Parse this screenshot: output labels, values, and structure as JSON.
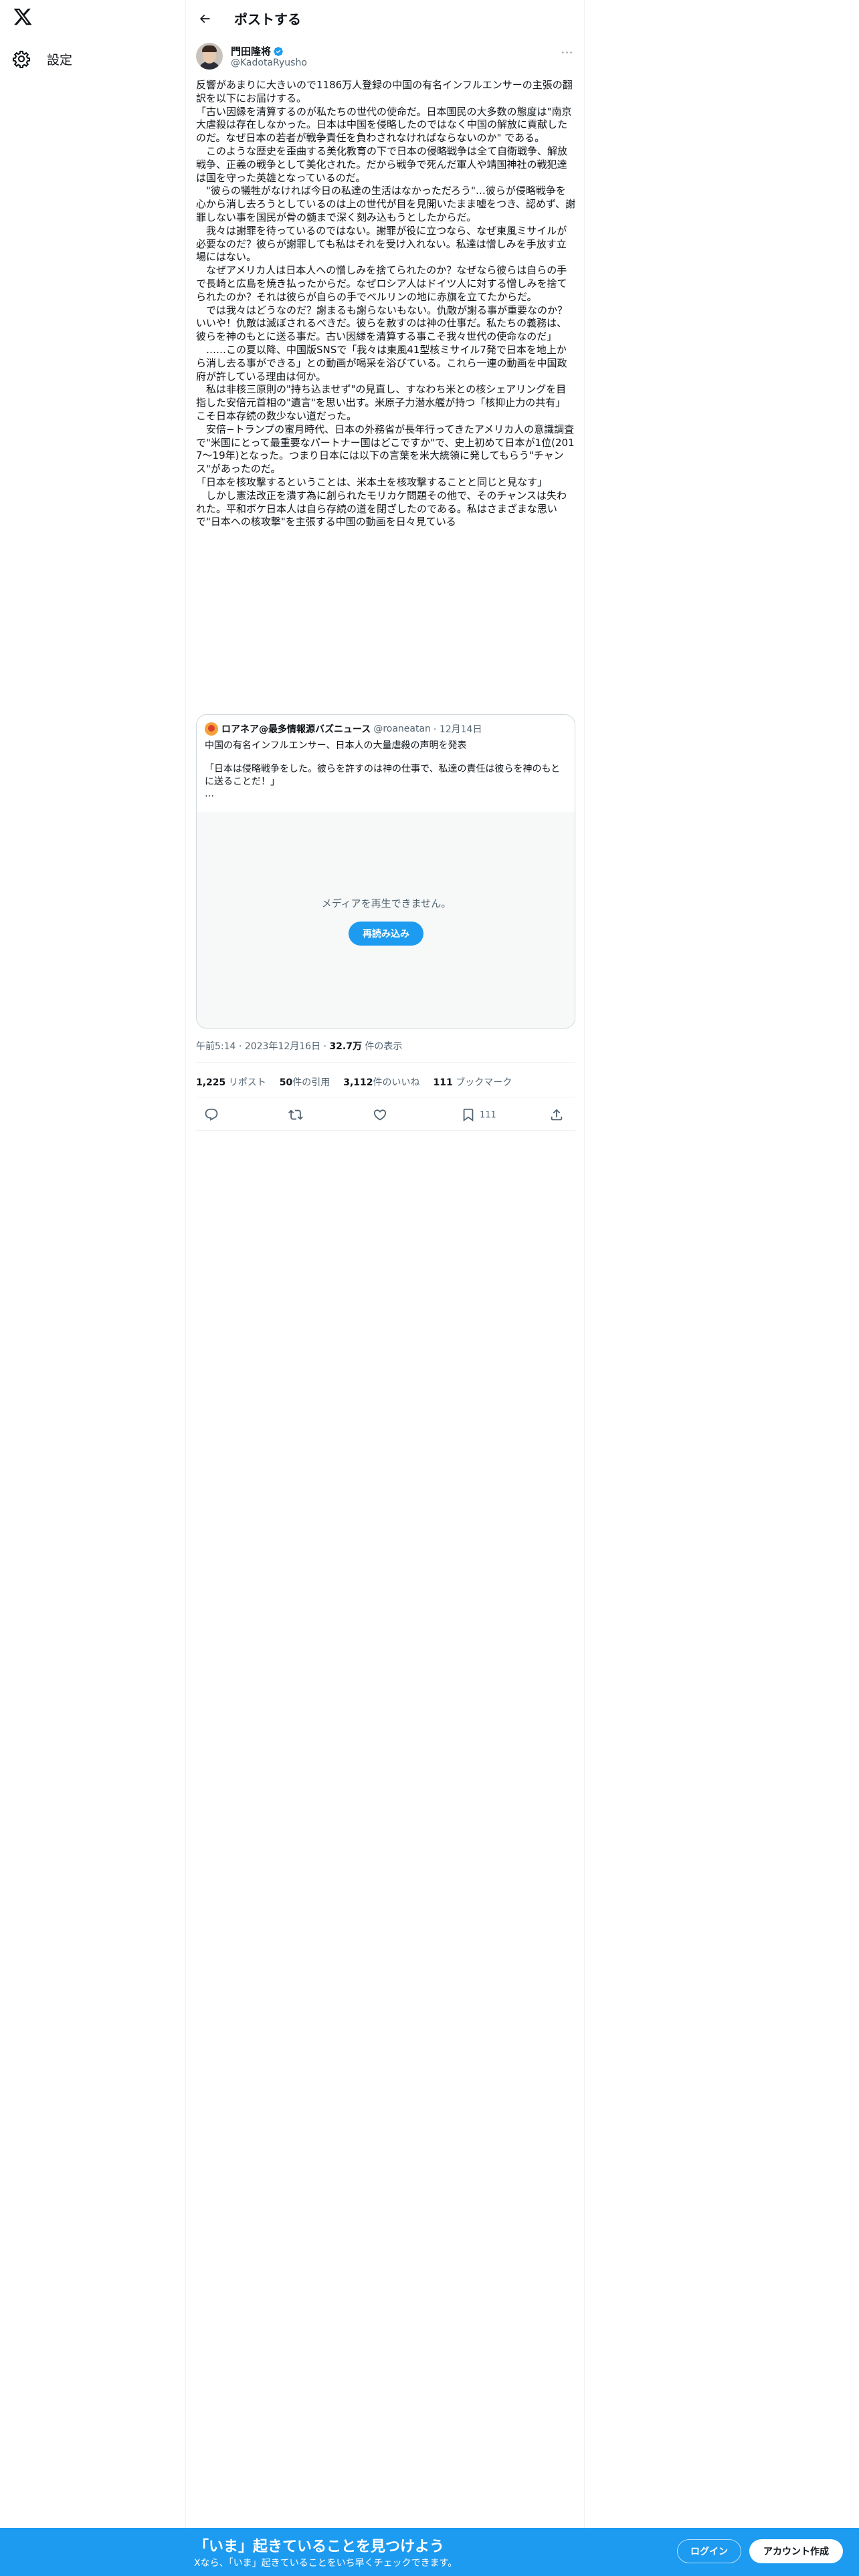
{
  "sidebar": {
    "logo_icon": "x-logo-icon",
    "settings_label": "設定",
    "settings_icon": "gear-icon"
  },
  "header": {
    "back_icon": "back-arrow-icon",
    "title": "ポストする"
  },
  "author": {
    "name": "門田隆将",
    "handle": "@KadotaRyusho",
    "verified": true
  },
  "tweet": {
    "text": "反響があまりに大きいので1186万人登録の中国の有名インフルエンサーの主張の翻訳を以下にお届けする。\n「古い因縁を清算するのが私たちの世代の使命だ。日本国民の大多数の態度は\"南京大虐殺は存在しなかった。日本は中国を侵略したのではなく中国の解放に貢献したのだ。なぜ日本の若者が戦争責任を負わされなければならないのか\" である。\n　このような歴史を歪曲する美化教育の下で日本の侵略戦争は全て自衛戦争、解放戦争、正義の戦争として美化された。だから戦争で死んだ軍人や靖国神社の戦犯達は国を守った英雄となっているのだ。\n　\"彼らの犠牲がなければ今日の私達の生活はなかっただろう\"…彼らが侵略戦争を心から消し去ろうとしているのは上の世代が目を見開いたまま嘘をつき、認めず、謝罪しない事を国民が骨の髄まで深く刻み込もうとしたからだ。\n　我々は謝罪を待っているのではない。謝罪が役に立つなら、なぜ東風ミサイルが必要なのだ？彼らが謝罪しても私はそれを受け入れない。私達は憎しみを手放す立場にはない。\n　なぜアメリカ人は日本人への憎しみを捨てられたのか？なぜなら彼らは自らの手で長崎と広島を焼き払ったからだ。なぜロシア人はドイツ人に対する憎しみを捨てられたのか？それは彼らが自らの手でベルリンの地に赤旗を立てたからだ。\n　では我々はどうなのだ？謝まるも謝らないもない。仇敵が謝る事が重要なのか？いいや！仇敵は滅ぼされるべきだ。彼らを赦すのは神の仕事だ。私たちの義務は、彼らを神のもとに送る事だ。古い因縁を清算する事こそ我々世代の使命なのだ」\n　……この夏以降、中国版SNSで「我々は東風41型核ミサイル7発で日本を地上から消し去る事ができる」との動画が喝采を浴びている。これら一連の動画を中国政府が許している理由は何か。\n　私は非核三原則の\"持ち込ませず\"の見直し、すなわち米との核シェアリングを目指した安倍元首相の\"遺言\"を思い出す。米原子力潜水艦が持つ「核抑止力の共有」こそ日本存続の数少ない道だった。\n　安倍−トランプの蜜月時代、日本の外務省が長年行ってきたアメリカ人の意識調査で\"米国にとって最重要なパートナー国はどこですか\"で、史上初めて日本が1位(2017〜19年)となった。つまり日本には以下の言葉を米大統領に発してもらう\"チャンス\"があったのだ。\n「日本を核攻撃するということは、米本土を核攻撃することと同じと見なす」\n　しかし憲法改正を潰す為に創られたモリカケ問題その他で、そのチャンスは失われた。平和ボケ日本人は自ら存続の道を閉ざしたのである。私はさまざまな思いで\"日本への核攻撃\"を主張する中国の動画を日々見ている"
  },
  "quote": {
    "name": "ロアネア@最多情報源バズニュース",
    "handle": "@roaneatan",
    "date": "· 12月14日",
    "line1": "中国の有名インフルエンサー、日本人の大量虐殺の声明を発表",
    "line2": "「日本は侵略戦争をした。彼らを許すのは神の仕事で、私達の責任は彼らを神のもとに送ることだ！」",
    "ellipsis": "…",
    "media_message": "メディアを再生できません。",
    "reload_label": "再読み込み"
  },
  "meta": {
    "time": "午前5:14",
    "date": "2023年12月16日",
    "views_count": "32.7万",
    "views_label": "件の表示"
  },
  "stats": {
    "reposts_count": "1,225",
    "reposts_label": "リポスト",
    "quotes_count": "50",
    "quotes_label": "件の引用",
    "likes_count": "3,112",
    "likes_label": "件のいいね",
    "bookmarks_count": "111",
    "bookmarks_label": "ブックマーク"
  },
  "actions": {
    "bookmark_count": "111"
  },
  "banner": {
    "title": "「いま」起きていることを見つけよう",
    "subtitle": "Xなら、「いま」起きていることをいち早くチェックできます。",
    "login_label": "ログイン",
    "signup_label": "アカウント作成"
  },
  "colors": {
    "accent": "#1d9bf0",
    "text": "#0f1419",
    "secondary": "#536471",
    "border": "#cfd9de"
  }
}
